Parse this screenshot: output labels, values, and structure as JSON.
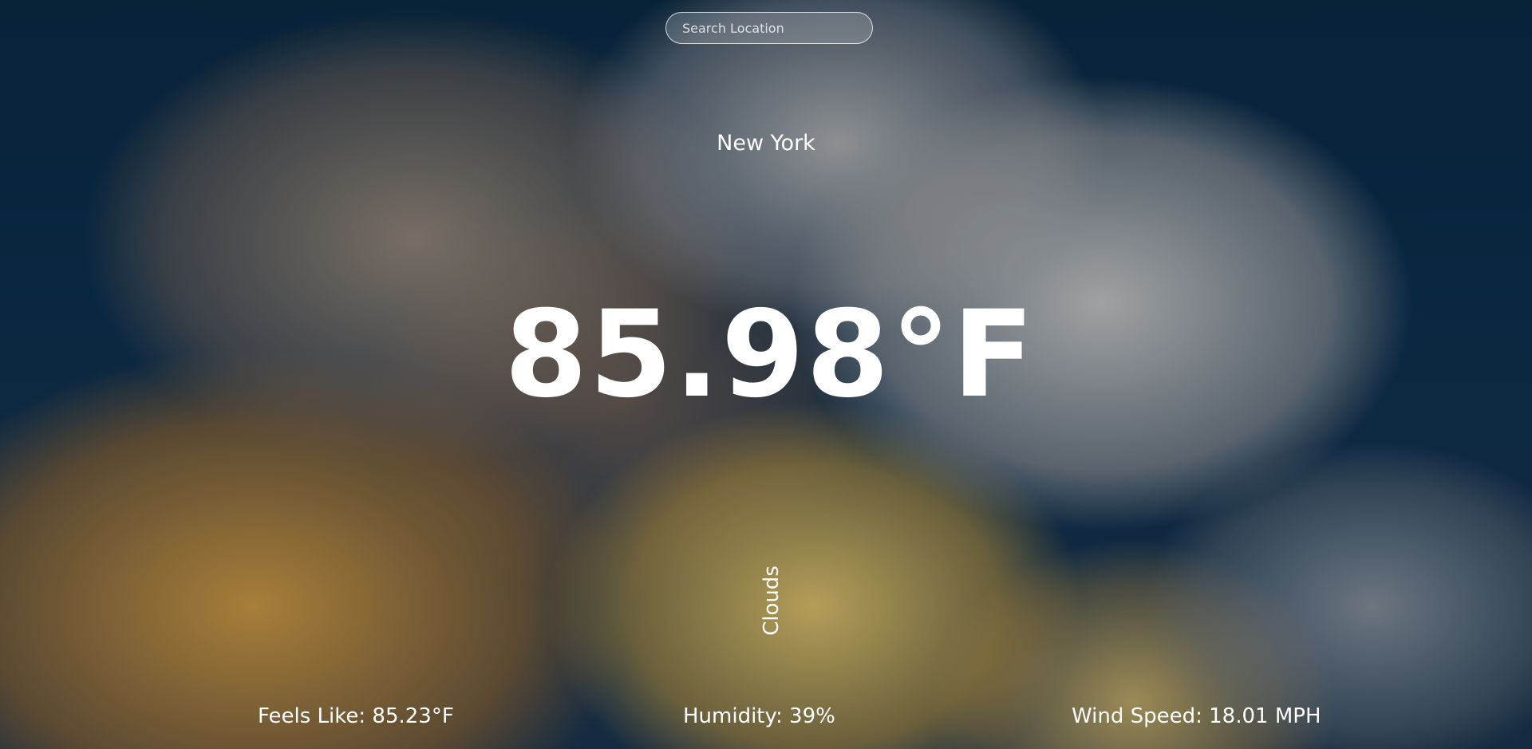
{
  "search": {
    "placeholder": "Search Location",
    "value": ""
  },
  "location": {
    "city": "New York"
  },
  "current": {
    "temperature": "85.98°F",
    "condition": "Clouds"
  },
  "details": {
    "feels_like": "Feels Like: 85.23°F",
    "humidity": "Humidity: 39%",
    "wind_speed": "Wind Speed: 18.01 MPH"
  },
  "background": {
    "description_icon": "cloudy-sky-background"
  }
}
